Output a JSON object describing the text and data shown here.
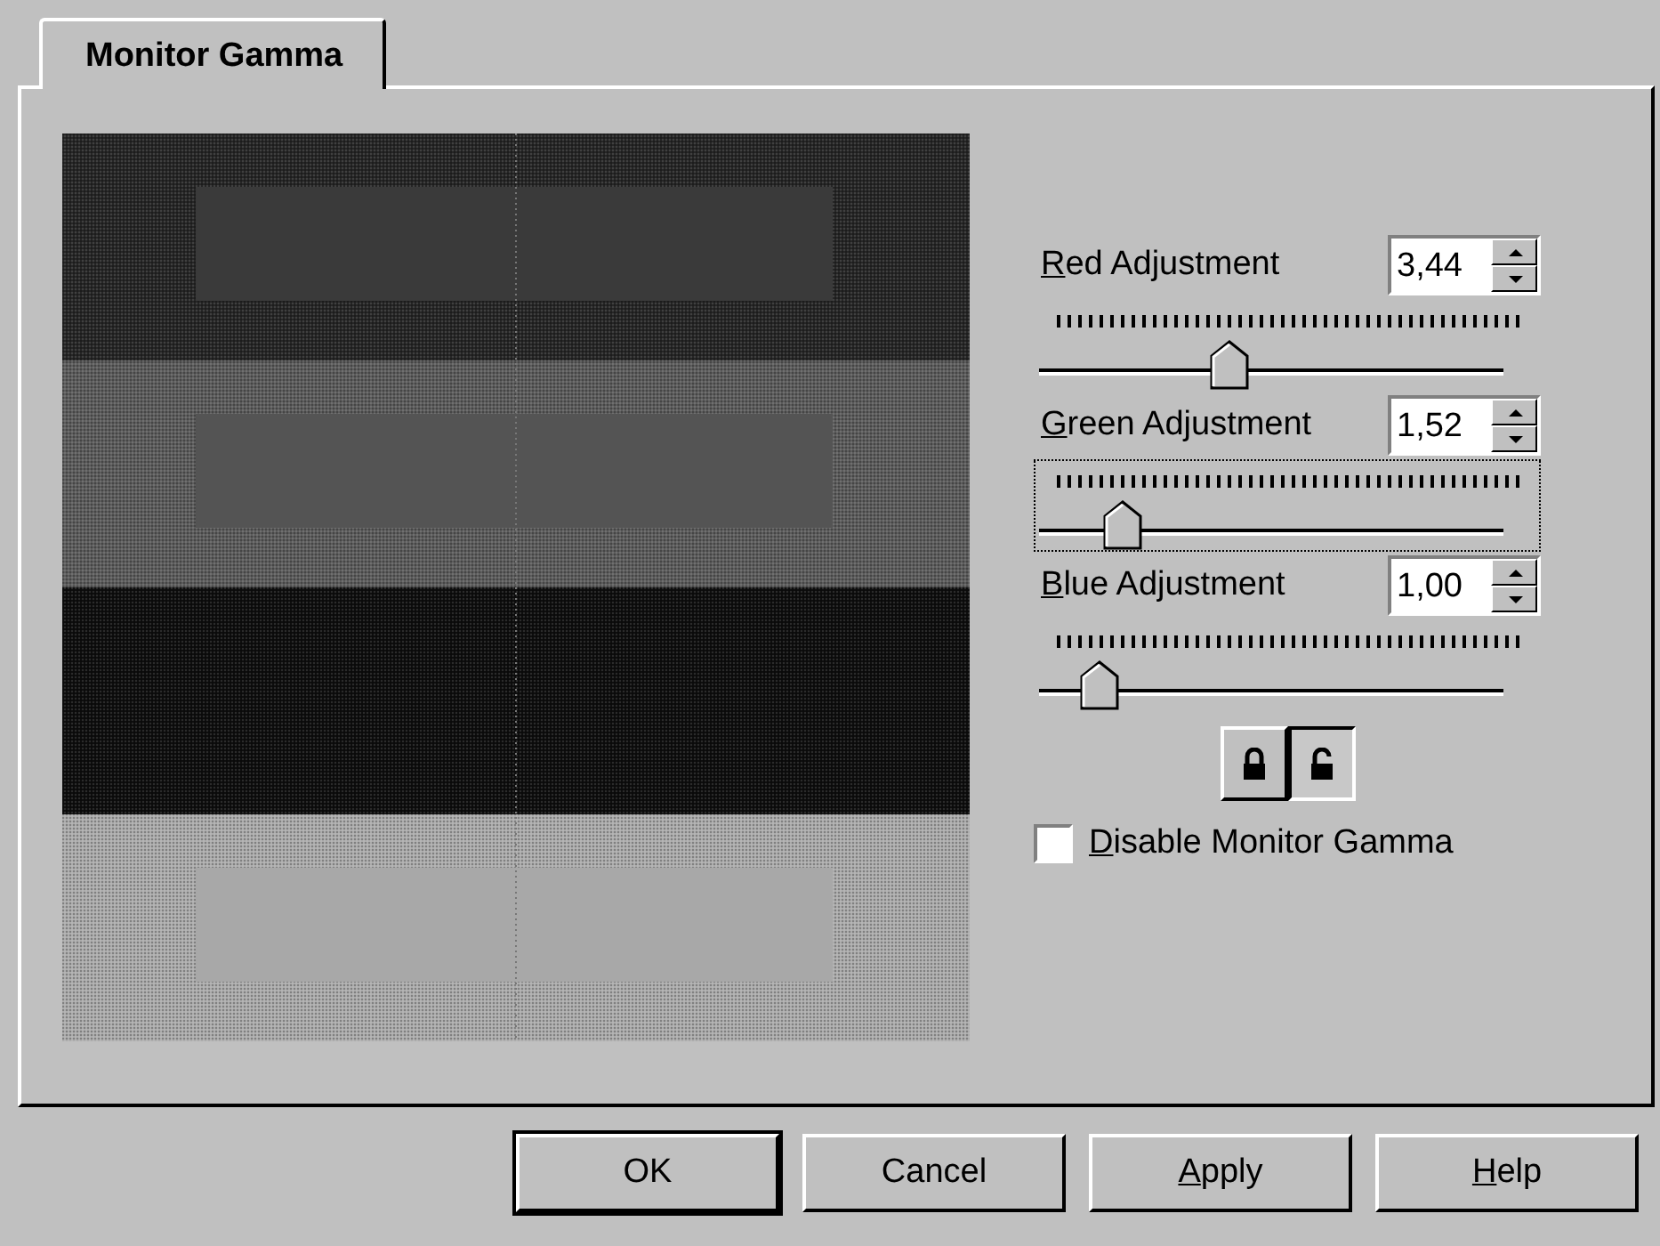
{
  "tabs": [
    {
      "label": "Monitor Gamma",
      "selected": true
    }
  ],
  "pattern": {
    "kind": "gamma-pattern"
  },
  "adjustments": [
    {
      "label": {
        "key": "R",
        "rest": "ed Adjustment"
      },
      "value": "3,44",
      "level": 0.41,
      "focused": false
    },
    {
      "label": {
        "key": "G",
        "rest": "reen Adjustment"
      },
      "value": "1,52",
      "level": 0.18,
      "focused": true
    },
    {
      "label": {
        "key": "B",
        "rest": "lue Adjustment"
      },
      "value": "1,00",
      "level": 0.13,
      "focused": false
    }
  ],
  "lock_buttons": [
    {
      "kind": "locked",
      "selected": false
    },
    {
      "kind": "unlocked",
      "selected": true
    }
  ],
  "disable_checkbox": {
    "label": {
      "key": "D",
      "rest": "isable Monitor Gamma"
    },
    "checked": false
  },
  "buttons": [
    {
      "label": {
        "rest": "OK"
      },
      "default": true
    },
    {
      "label": {
        "rest": "Cancel"
      },
      "default": false
    },
    {
      "label": {
        "key": "A",
        "rest": "pply"
      },
      "default": false
    },
    {
      "label": {
        "key": "H",
        "rest": "elp"
      },
      "default": false
    }
  ]
}
